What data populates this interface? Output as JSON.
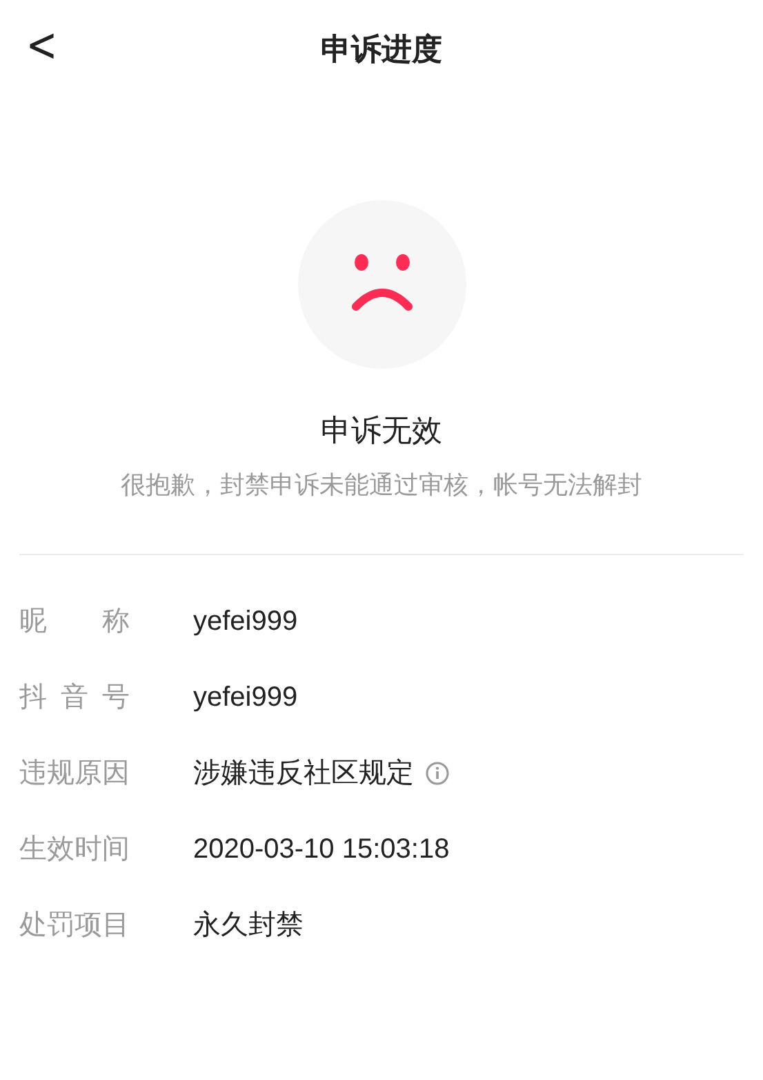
{
  "header": {
    "back": "<",
    "title": "申诉进度"
  },
  "result": {
    "title": "申诉无效",
    "message": "很抱歉，封禁申诉未能通过审核，帐号无法解封"
  },
  "details": [
    {
      "label": "昵称",
      "value": "yefei999",
      "info": false
    },
    {
      "label": "抖音号",
      "value": "yefei999",
      "info": false
    },
    {
      "label": "违规原因",
      "value": "涉嫌违反社区规定",
      "info": true
    },
    {
      "label": "生效时间",
      "value": "2020-03-10 15:03:18",
      "info": false
    },
    {
      "label": "处罚项目",
      "value": "永久封禁",
      "info": false
    }
  ]
}
